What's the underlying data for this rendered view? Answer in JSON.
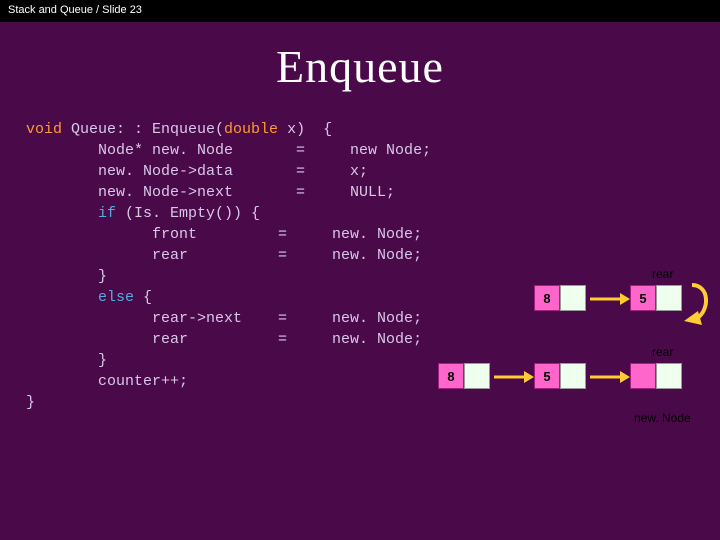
{
  "header": {
    "text": "Stack and Queue / Slide 23"
  },
  "title": "Enqueue",
  "code": {
    "l01a": "void",
    "l01b": " Queue: : Enqueue(",
    "l01c": "double",
    "l01d": " x)  {",
    "l02": "        Node* new. Node       =     new Node;",
    "l03": "        new. Node->data       =     x;",
    "l04": "        new. Node->next       =     NULL;",
    "l05a": "        ",
    "l05b": "if",
    "l05c": " (Is. Empty()) {",
    "l06": "              front         =     new. Node;",
    "l07": "              rear          =     new. Node;",
    "l08": "        }",
    "l09a": "        ",
    "l09b": "else",
    "l09c": " {",
    "l10": "              rear->next    =     new. Node;",
    "l11": "              rear          =     new. Node;",
    "l12": "        }",
    "l13": "        counter++;",
    "l14": "}"
  },
  "diagram": {
    "rear_label": "rear",
    "newnode_label": "new. Node",
    "top": {
      "a": "8",
      "b": "5"
    },
    "bot": {
      "a": "8",
      "b": "5",
      "c": ""
    }
  }
}
